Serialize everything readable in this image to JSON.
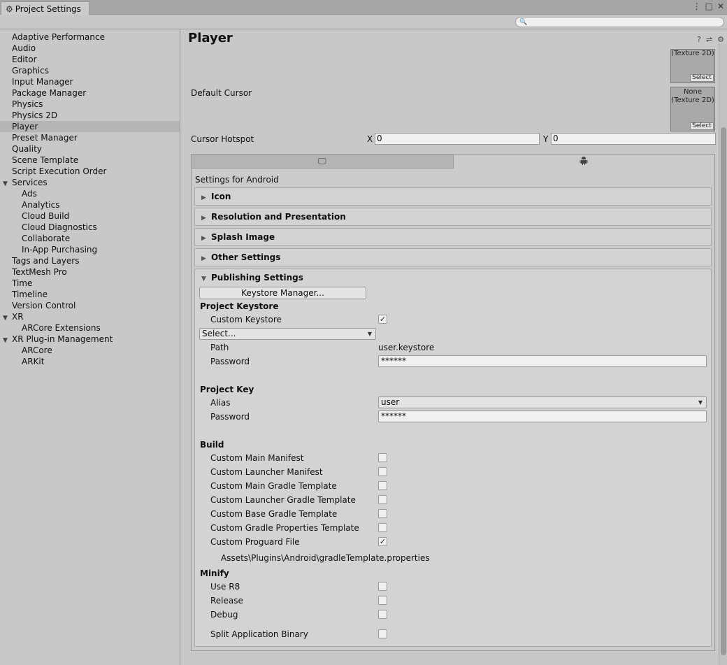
{
  "window": {
    "tab_title": "Project Settings",
    "search_placeholder": ""
  },
  "sidebar": {
    "items": [
      {
        "label": "Adaptive Performance",
        "level": 0
      },
      {
        "label": "Audio",
        "level": 0
      },
      {
        "label": "Editor",
        "level": 0
      },
      {
        "label": "Graphics",
        "level": 0
      },
      {
        "label": "Input Manager",
        "level": 0
      },
      {
        "label": "Package Manager",
        "level": 0
      },
      {
        "label": "Physics",
        "level": 0
      },
      {
        "label": "Physics 2D",
        "level": 0
      },
      {
        "label": "Player",
        "level": 0,
        "selected": true
      },
      {
        "label": "Preset Manager",
        "level": 0
      },
      {
        "label": "Quality",
        "level": 0
      },
      {
        "label": "Scene Template",
        "level": 0
      },
      {
        "label": "Script Execution Order",
        "level": 0
      },
      {
        "label": "Services",
        "level": 0,
        "expanded": true
      },
      {
        "label": "Ads",
        "level": 1
      },
      {
        "label": "Analytics",
        "level": 1
      },
      {
        "label": "Cloud Build",
        "level": 1
      },
      {
        "label": "Cloud Diagnostics",
        "level": 1
      },
      {
        "label": "Collaborate",
        "level": 1
      },
      {
        "label": "In-App Purchasing",
        "level": 1
      },
      {
        "label": "Tags and Layers",
        "level": 0
      },
      {
        "label": "TextMesh Pro",
        "level": 0
      },
      {
        "label": "Time",
        "level": 0
      },
      {
        "label": "Timeline",
        "level": 0
      },
      {
        "label": "Version Control",
        "level": 0
      },
      {
        "label": "XR",
        "level": 0,
        "expanded": true
      },
      {
        "label": "ARCore Extensions",
        "level": 1
      },
      {
        "label": "XR Plug-in Management",
        "level": 0,
        "expanded": true
      },
      {
        "label": "ARCore",
        "level": 1
      },
      {
        "label": "ARKit",
        "level": 1
      }
    ]
  },
  "main": {
    "title": "Player",
    "default_icon_texture_label": "(Texture 2D)",
    "default_cursor_label": "Default Cursor",
    "default_cursor_texture_none": "None",
    "default_cursor_texture_type": "(Texture 2D)",
    "select_label": "Select",
    "cursor_hotspot_label": "Cursor Hotspot",
    "hotspot_x_label": "X",
    "hotspot_x_value": "0",
    "hotspot_y_label": "Y",
    "hotspot_y_value": "0",
    "settings_for": "Settings for Android",
    "foldouts": [
      "Icon",
      "Resolution and Presentation",
      "Splash Image",
      "Other Settings"
    ],
    "publishing": {
      "title": "Publishing Settings",
      "keystore_manager_button": "Keystore Manager...",
      "project_keystore_header": "Project Keystore",
      "custom_keystore_label": "Custom Keystore",
      "custom_keystore_checked": true,
      "keystore_select_value": "Select...",
      "path_label": "Path",
      "path_value": "user.keystore",
      "password_label": "Password",
      "keystore_password_value": "******",
      "project_key_header": "Project Key",
      "alias_label": "Alias",
      "alias_value": "user",
      "key_password_value": "******",
      "build_header": "Build",
      "build_items": [
        {
          "label": "Custom Main Manifest",
          "checked": false
        },
        {
          "label": "Custom Launcher Manifest",
          "checked": false
        },
        {
          "label": "Custom Main Gradle Template",
          "checked": false
        },
        {
          "label": "Custom Launcher Gradle Template",
          "checked": false
        },
        {
          "label": "Custom Base Gradle Template",
          "checked": false
        },
        {
          "label": "Custom Gradle Properties Template",
          "checked": false
        },
        {
          "label": "Custom Proguard File",
          "checked": true
        }
      ],
      "proguard_path": "Assets\\Plugins\\Android\\gradleTemplate.properties",
      "minify_header": "Minify",
      "minify_items": [
        {
          "label": "Use R8",
          "checked": false
        },
        {
          "label": "Release",
          "checked": false
        },
        {
          "label": "Debug",
          "checked": false
        }
      ],
      "split_binary_label": "Split Application Binary",
      "split_binary_checked": false
    }
  }
}
